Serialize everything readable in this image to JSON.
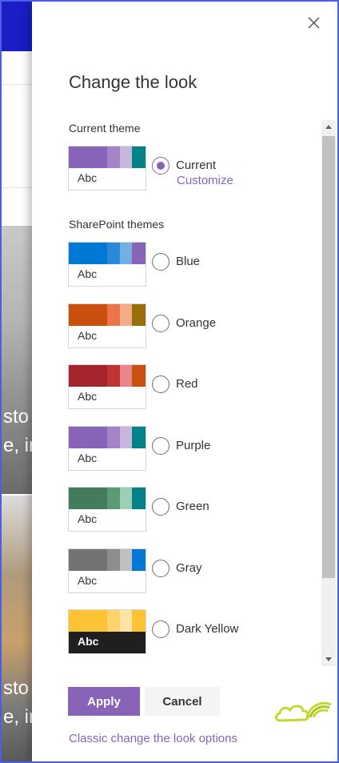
{
  "background": {
    "snippets": [
      {
        "text": "sto"
      },
      {
        "text": "e, ir"
      },
      {
        "text": "sto"
      },
      {
        "text": "e, ir"
      }
    ]
  },
  "panel": {
    "title": "Change the look",
    "close_icon": "close-icon",
    "current_section": {
      "heading": "Current theme",
      "theme": {
        "label": "Current",
        "sample_text": "Abc",
        "colors": [
          "#8764b8",
          "#8764b8",
          "#a284c7",
          "#c8b6dc",
          "#038387"
        ],
        "selected": true
      },
      "customize_label": "Customize"
    },
    "sharepoint_section": {
      "heading": "SharePoint themes",
      "themes": [
        {
          "label": "Blue",
          "sample_text": "Abc",
          "colors": [
            "#0078d4",
            "#0078d4",
            "#2b88d8",
            "#71afe5",
            "#8764b8"
          ],
          "dark": false
        },
        {
          "label": "Orange",
          "sample_text": "Abc",
          "colors": [
            "#ca5010",
            "#ca5010",
            "#e97548",
            "#f4ab88",
            "#986f0b"
          ],
          "dark": false
        },
        {
          "label": "Red",
          "sample_text": "Abc",
          "colors": [
            "#a4262c",
            "#a4262c",
            "#c23434",
            "#e8868b",
            "#ca5010"
          ],
          "dark": false
        },
        {
          "label": "Purple",
          "sample_text": "Abc",
          "colors": [
            "#8764b8",
            "#8764b8",
            "#a284c7",
            "#c8b6dc",
            "#038387"
          ],
          "dark": false
        },
        {
          "label": "Green",
          "sample_text": "Abc",
          "colors": [
            "#498205",
            "#437c5c",
            "#5a9a74",
            "#9ccfb4",
            "#038387"
          ],
          "dark": false
        },
        {
          "label": "Gray",
          "sample_text": "Abc",
          "colors": [
            "#737373",
            "#737373",
            "#8d8d8d",
            "#c0c0c0",
            "#0078d4"
          ],
          "dark": false
        },
        {
          "label": "Dark Yellow",
          "sample_text": "Abc",
          "colors": [
            "#fdc334",
            "#fdc334",
            "#fdd26b",
            "#fde3a4",
            "#fdc334"
          ],
          "dark": true
        }
      ]
    },
    "buttons": {
      "apply": "Apply",
      "cancel": "Cancel"
    },
    "classic_link": "Classic change the look options",
    "accent_color": "#8764b8",
    "logo_icon": "cloud-rainbow-logo-icon"
  }
}
